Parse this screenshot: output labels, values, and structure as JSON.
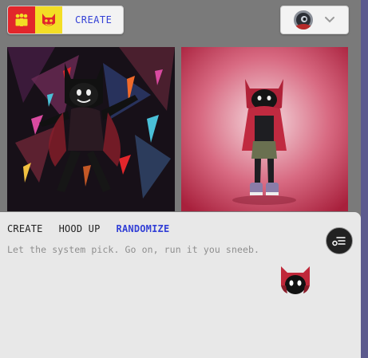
{
  "toolbar": {
    "create_label": "CREATE",
    "icons": [
      "people-icon",
      "cat-mask-icon"
    ]
  },
  "profile": {
    "avatar": "avatar",
    "menu_icon": "chevron-down-icon"
  },
  "gallery": {
    "images": [
      {
        "name": "hooded-character-shatter-art"
      },
      {
        "name": "hooded-character-red-backdrop"
      }
    ]
  },
  "panel": {
    "tabs": [
      {
        "label": "CREATE"
      },
      {
        "label": "HOOD UP"
      },
      {
        "label": "RANDOMIZE",
        "active": true
      }
    ],
    "hint": "Let the system pick. Go on, run it you sneeb.",
    "menu_icon": "options-icon",
    "mascot_icon": "hood-mascot-icon"
  },
  "colors": {
    "accent": "#3340d6",
    "red": "#e2262b",
    "yellow": "#f3de25",
    "panel_bg": "#e8e8e8"
  }
}
